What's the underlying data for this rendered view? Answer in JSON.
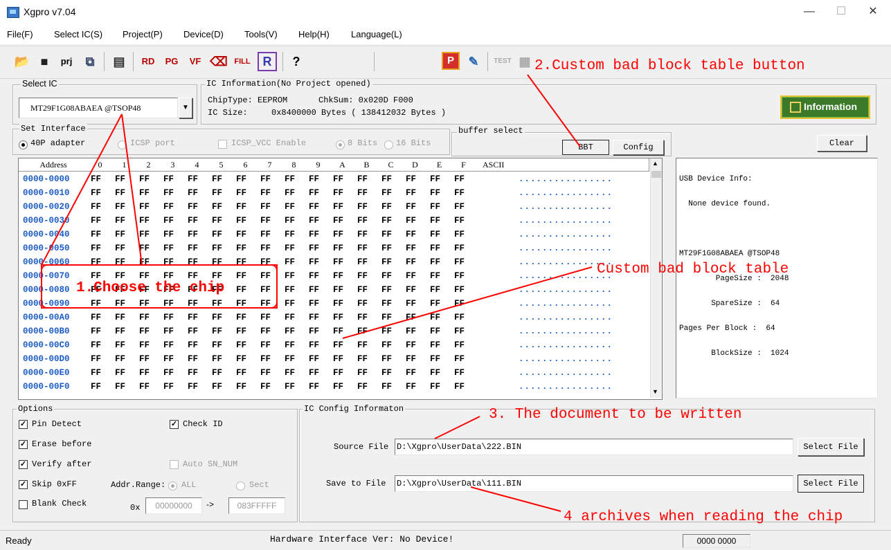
{
  "window": {
    "title": "Xgpro v7.04",
    "minimize": "—",
    "maximize": "☐",
    "close": "✕"
  },
  "menu": [
    "File(F)",
    "Select IC(S)",
    "Project(P)",
    "Device(D)",
    "Tools(V)",
    "Help(H)",
    "Language(L)"
  ],
  "select_ic": {
    "label": "Select IC",
    "chip": "MT29F1G08ABAEA @TSOP48"
  },
  "ic_info": {
    "label": "IC Information(No Project opened)",
    "chip_type": "ChipType:  EEPROM",
    "checksum": "ChkSum:  0x020D F000",
    "ic_size_label": "IC Size:",
    "ic_size_value": "0x8400000 Bytes ( 138412032 Bytes )",
    "information_button": "Information"
  },
  "interface": {
    "label": "Set Interface",
    "adapter": "40P adapter",
    "icsp_port": "ICSP port",
    "icsp_vcc": "ICSP_VCC Enable",
    "bits8": "8 Bits",
    "bits16": "16 Bits"
  },
  "buffer": {
    "label": "buffer select",
    "bbt": "BBT",
    "config": "Config",
    "clear": "Clear"
  },
  "hex": {
    "headers": [
      "Address",
      "0",
      "1",
      "2",
      "3",
      "4",
      "5",
      "6",
      "7",
      "8",
      "9",
      "A",
      "B",
      "C",
      "D",
      "E",
      "F",
      "ASCII"
    ],
    "addresses": [
      "0000-0000",
      "0000-0010",
      "0000-0020",
      "0000-0030",
      "0000-0040",
      "0000-0050",
      "0000-0060",
      "0000-0070",
      "0000-0080",
      "0000-0090",
      "0000-00A0",
      "0000-00B0",
      "0000-00C0",
      "0000-00D0",
      "0000-00E0",
      "0000-00F0"
    ],
    "byte": "FF",
    "ascii": "................"
  },
  "device_info": [
    "USB Device Info:",
    "  None device found.",
    "",
    "MT29F1G08ABAEA @TSOP48",
    "        PageSize :  2048",
    "       SpareSize :  64",
    "Pages Per Block :  64",
    "       BlockSize :  1024"
  ],
  "options": {
    "label": "Options",
    "pin_detect": "Pin Detect",
    "check_id": "Check ID",
    "erase_before": "Erase before",
    "verify_after": "Verify after",
    "auto_sn": "Auto SN_NUM",
    "skip_ff": "Skip 0xFF",
    "addr_range": "Addr.Range:",
    "all": "ALL",
    "sect": "Sect",
    "blank_check": "Blank Check",
    "hex_prefix": "0x",
    "range_start": "00000000",
    "arrow": "->",
    "range_end": "083FFFFF"
  },
  "config": {
    "label": "IC Config Informaton",
    "source_label": "Source File",
    "source_value": "D:\\Xgpro\\UserData\\222.BIN",
    "save_label": "Save to File",
    "save_value": "D:\\Xgpro\\UserData\\111.BIN",
    "select_file": "Select File"
  },
  "status": {
    "left": "Ready",
    "center": "Hardware Interface Ver: No Device!",
    "right": "0000 0000"
  },
  "annotations": {
    "a1": "1.Choose the chip",
    "a2": "2.Custom bad block table button",
    "a_bbt": "Custom bad block table",
    "a3": "3. The document to be written",
    "a4": "4 archives when reading the chip"
  },
  "colors": {
    "annotation": "#ff0000",
    "address_blue": "#1c5cc8"
  }
}
